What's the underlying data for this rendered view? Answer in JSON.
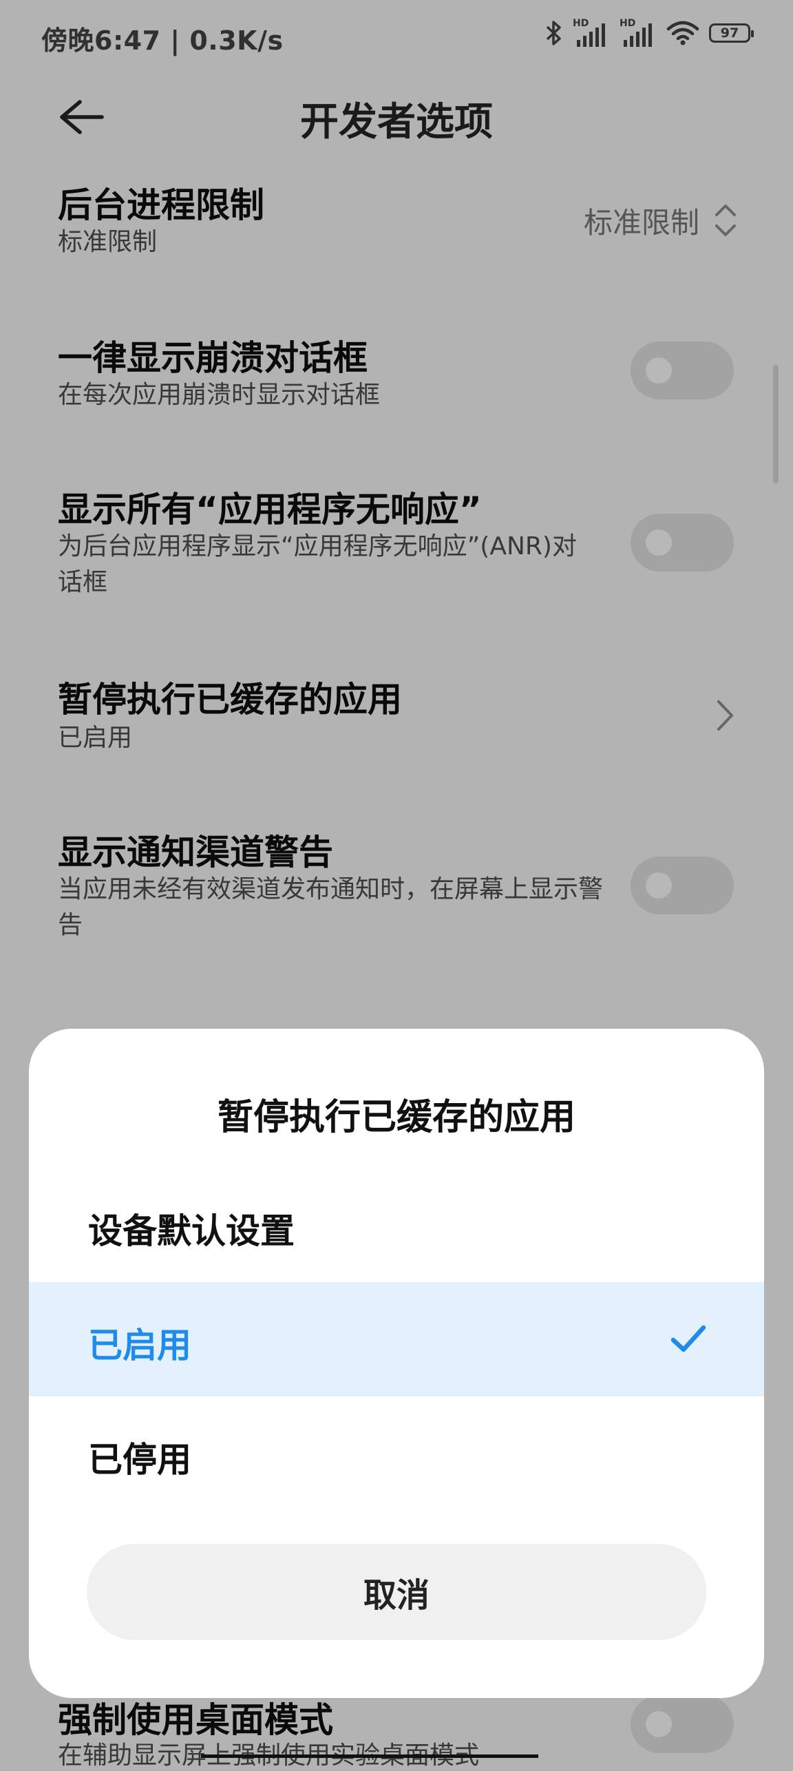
{
  "status_bar": {
    "time_speed": "傍晚6:47 | 0.3K/s",
    "hd1": "HD",
    "hd2": "HD",
    "battery": "97"
  },
  "header": {
    "title": "开发者选项"
  },
  "rows": {
    "bg_limit": {
      "title": "后台进程限制",
      "subtitle": "标准限制",
      "value": "标准限制"
    },
    "crash_dialog": {
      "title": "一律显示崩溃对话框",
      "subtitle": "在每次应用崩溃时显示对话框",
      "enabled": false
    },
    "anr": {
      "title": "显示所有“应用程序无响应”",
      "subtitle": "为后台应用程序显示“应用程序无响应”(ANR)对话框",
      "enabled": false
    },
    "cached_apps": {
      "title": "暂停执行已缓存的应用",
      "subtitle": "已启用"
    },
    "channel_warn": {
      "title": "显示通知渠道警告",
      "subtitle": "当应用未经有效渠道发布通知时，在屏幕上显示警告",
      "enabled": false
    },
    "desktop_mode": {
      "title": "强制使用桌面模式",
      "subtitle": "在辅助显示屏上强制使用实验桌面模式",
      "enabled": false
    }
  },
  "dialog": {
    "title": "暂停执行已缓存的应用",
    "options": [
      {
        "label": "设备默认设置",
        "selected": false
      },
      {
        "label": "已启用",
        "selected": true
      },
      {
        "label": "已停用",
        "selected": false
      }
    ],
    "cancel_label": "取消",
    "accent_color": "#1f8bea"
  }
}
